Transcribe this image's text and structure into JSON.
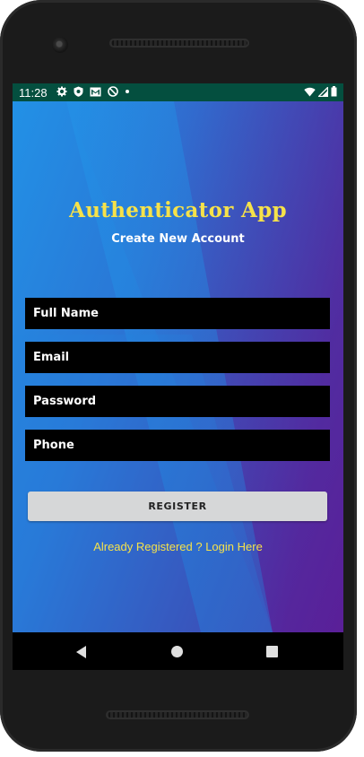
{
  "status_bar": {
    "time": "11:28",
    "left_icons": [
      "gear-icon",
      "shield-icon",
      "gmail-icon",
      "dnd-icon",
      "dot-icon"
    ],
    "right_icons": [
      "wifi-icon",
      "signal-icon",
      "battery-icon"
    ],
    "color": "#044f3f"
  },
  "app": {
    "title": "Authenticator App",
    "subtitle": "Create New Account",
    "fields": {
      "full_name_placeholder": "Full Name",
      "email_placeholder": "Email",
      "password_placeholder": "Password",
      "phone_placeholder": "Phone"
    },
    "register_label": "REGISTER",
    "login_link": "Already Registered ? Login Here",
    "colors": {
      "title": "#f6e24a",
      "field_bg": "#000000",
      "gradient_start": "#2291e6",
      "gradient_end": "#5a1f98",
      "button_bg": "#d6d7d8"
    }
  },
  "nav_bar": {
    "buttons": [
      "back-icon",
      "home-icon",
      "recents-icon"
    ]
  }
}
